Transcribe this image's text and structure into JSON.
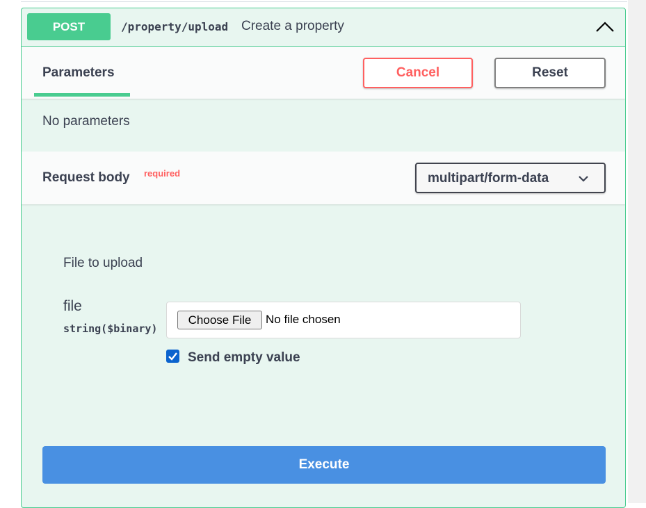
{
  "operation": {
    "method": "POST",
    "path": "/property/upload",
    "summary": "Create a property",
    "collapse_icon": "chevron-up-icon",
    "accent_color": "#49cc90"
  },
  "parameters": {
    "tab_label": "Parameters",
    "cancel_label": "Cancel",
    "reset_label": "Reset",
    "empty_text": "No parameters"
  },
  "request_body": {
    "label": "Request body",
    "required_label": "required",
    "content_type": "multipart/form-data",
    "dropdown_icon": "chevron-down-icon",
    "section_title": "File to upload",
    "field": {
      "name": "file",
      "type": "string($binary)",
      "choose_label": "Choose File",
      "status": "No file chosen"
    },
    "send_empty": {
      "label": "Send empty value",
      "checked": true
    }
  },
  "execute_label": "Execute",
  "colors": {
    "cancel": "#ff6060",
    "execute": "#4990e2"
  }
}
